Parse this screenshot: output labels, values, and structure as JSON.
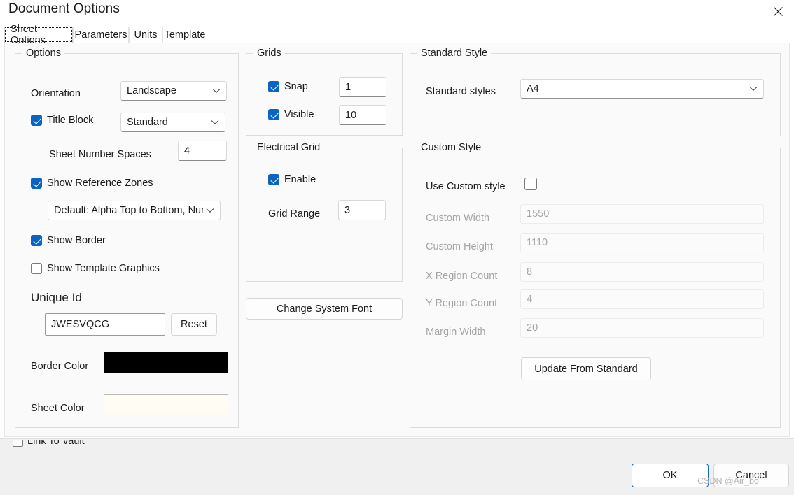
{
  "window": {
    "title": "Document Options",
    "close_icon": "close-icon"
  },
  "tabs": [
    {
      "label": "Sheet Options",
      "selected": true
    },
    {
      "label": "Parameters",
      "selected": false
    },
    {
      "label": "Units",
      "selected": false
    },
    {
      "label": "Template",
      "selected": false
    }
  ],
  "options_group": {
    "legend": "Options",
    "orientation_label": "Orientation",
    "orientation_value": "Landscape",
    "title_block_label": "Title Block",
    "title_block_checked": true,
    "title_block_value": "Standard",
    "sheet_number_spaces_label": "Sheet Number Spaces",
    "sheet_number_spaces_value": "4",
    "show_reference_zones_label": "Show Reference Zones",
    "show_reference_zones_checked": true,
    "reference_zones_value": "Default: Alpha Top to Bottom, Num",
    "show_border_label": "Show Border",
    "show_border_checked": true,
    "show_template_graphics_label": "Show Template Graphics",
    "show_template_graphics_checked": false,
    "unique_id_label": "Unique Id",
    "unique_id_value": "JWESVQCG",
    "reset_label": "Reset",
    "border_color_label": "Border Color",
    "border_color_value": "#000000",
    "sheet_color_label": "Sheet Color",
    "sheet_color_value": "#fffcf4"
  },
  "grids_group": {
    "legend": "Grids",
    "snap_label": "Snap",
    "snap_checked": true,
    "snap_value": "1",
    "visible_label": "Visible",
    "visible_checked": true,
    "visible_value": "10"
  },
  "electrical_grid_group": {
    "legend": "Electrical Grid",
    "enable_label": "Enable",
    "enable_checked": true,
    "grid_range_label": "Grid Range",
    "grid_range_value": "3"
  },
  "change_system_font_label": "Change System Font",
  "standard_style_group": {
    "legend": "Standard Style",
    "standard_styles_label": "Standard styles",
    "standard_styles_value": "A4"
  },
  "custom_style_group": {
    "legend": "Custom Style",
    "use_custom_style_label": "Use Custom style",
    "use_custom_style_checked": false,
    "custom_width_label": "Custom Width",
    "custom_width_value": "1550",
    "custom_height_label": "Custom Height",
    "custom_height_value": "1110",
    "x_region_count_label": "X Region Count",
    "x_region_count_value": "8",
    "y_region_count_label": "Y Region Count",
    "y_region_count_value": "4",
    "margin_width_label": "Margin Width",
    "margin_width_value": "20",
    "update_from_standard_label": "Update From Standard"
  },
  "footer": {
    "link_to_vault_label": "Link To Vault",
    "link_to_vault_checked": false,
    "ok_label": "OK",
    "cancel_label": "Cancel",
    "watermark": "CSDN @Air_bo"
  },
  "colors": {
    "accent": "#0a64c2",
    "primary_button_border": "#0f6cbd",
    "panel_bg": "#fafafa",
    "footer_bg": "#f0f0f0"
  }
}
